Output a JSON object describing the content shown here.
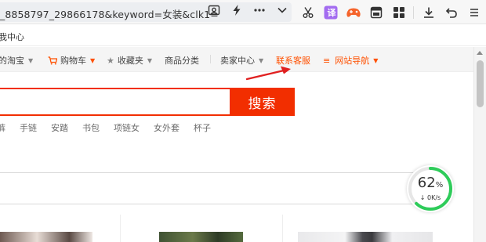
{
  "browser": {
    "url": "_8858797_29866178&keyword=女装&clk1=",
    "url_icons": [
      "image-search-icon",
      "lightning-icon",
      "more-icon",
      "chevron-down-icon"
    ],
    "toolbar_icons": [
      "scissors-icon",
      "translate-icon",
      "game-icon",
      "window-icon",
      "apps-icon",
      "download-icon",
      "undo-icon",
      "menu-icon"
    ],
    "translate_label": "译"
  },
  "bookmarks": {
    "item": "我中心"
  },
  "site_nav": {
    "my_taobao": "的淘宝",
    "cart": "购物车",
    "favorites": "收藏夹",
    "categories": "商品分类",
    "seller_center": "卖家中心",
    "contact_service": "联系客服",
    "site_nav": "网站导航"
  },
  "search": {
    "value": "",
    "button_label": "搜索",
    "hot_words": [
      "裤",
      "手链",
      "安踏",
      "书包",
      "项链女",
      "女外套",
      "杯子"
    ]
  },
  "speed_widget": {
    "percent": "62",
    "percent_sign": "%",
    "rate": "↓ 0K/s",
    "progress": 0.62
  },
  "colors": {
    "brand": "#f22e00",
    "accent": "#ff5000",
    "annotation": "#e02020",
    "progress": "#2ecc5a"
  }
}
